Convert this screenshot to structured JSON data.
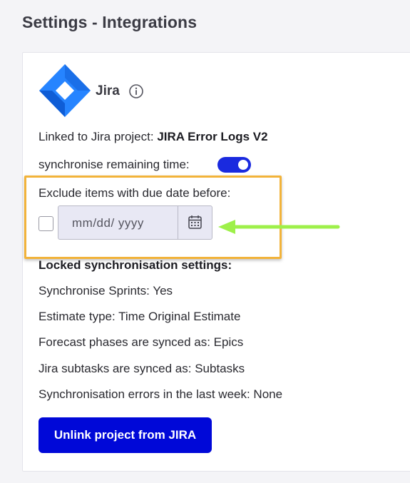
{
  "page": {
    "title": "Settings - Integrations"
  },
  "integration": {
    "name": "Jira",
    "logo_icon": "jira-logo",
    "info_icon": "info-icon",
    "linked_label": "Linked to Jira project: ",
    "linked_project": "JIRA Error Logs V2",
    "sync_remaining_label": "synchronise remaining time:",
    "sync_remaining_enabled": true,
    "exclude_label": "Exclude items with due date before:",
    "exclude_checked": false,
    "date_placeholder": "mm/dd/ yyyy",
    "calendar_icon": "calendar-icon",
    "locked_heading": "Locked synchronisation settings:",
    "settings": [
      "Synchronise Sprints: Yes",
      "Estimate type: Time Original Estimate",
      "Forecast phases are synced as: Epics",
      "Jira subtasks are synced as: Subtasks",
      "Synchronisation errors in the last week: None"
    ],
    "unlink_label": "Unlink project from JIRA"
  },
  "annotation": {
    "highlight_color": "#f2b33a",
    "arrow_color": "#9ef04a",
    "arrow_icon": "arrow-left-icon"
  },
  "colors": {
    "accent": "#0008d8",
    "toggle_on": "#1a2adf",
    "jira_blue": "#2684ff"
  }
}
